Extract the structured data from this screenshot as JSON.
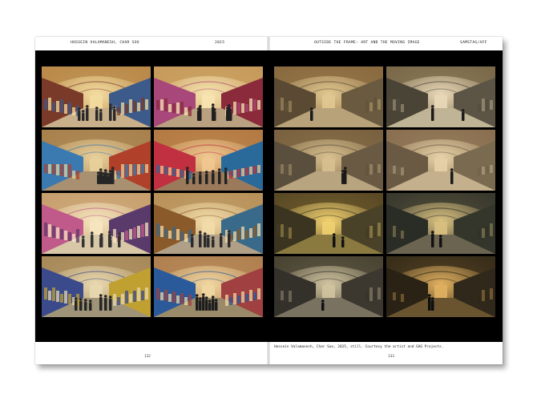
{
  "header": {
    "left_author": "HOSSEIN VALAMANESH, CHAR SOO",
    "left_year": "2015",
    "right_title": "OUTSIDE THE FRAME: ART AND THE MOVING IMAGE",
    "right_org": "SAMSTAG/AFF"
  },
  "caption": "Hossein Valamanesh, Char Soo, 2015, still. Courtesy the artist and GAG Projects.",
  "page_numbers": {
    "left": "132",
    "right": "133"
  },
  "left_frames": [
    {
      "label": "bazaar-busy-1",
      "palette": {
        "vault": "#b98a4a",
        "light": "#f3dca0",
        "wall1": "#7a3a2a",
        "wall2": "#3c5a8a",
        "floor": "#c9b08a",
        "crowd": "#2a2a2a"
      }
    },
    {
      "label": "bazaar-busy-2",
      "palette": {
        "vault": "#c69a5a",
        "light": "#f7e4b0",
        "wall1": "#a8477a",
        "wall2": "#8a2a3a",
        "floor": "#b8a080",
        "crowd": "#1f1f1f"
      }
    },
    {
      "label": "bazaar-busy-3",
      "palette": {
        "vault": "#a8814e",
        "light": "#e8d09a",
        "wall1": "#3a7ab0",
        "wall2": "#b0402a",
        "floor": "#a89070",
        "crowd": "#262626"
      }
    },
    {
      "label": "bazaar-busy-4",
      "palette": {
        "vault": "#b47a44",
        "light": "#f0c890",
        "wall1": "#c03040",
        "wall2": "#2a6a9a",
        "floor": "#9a7a5a",
        "crowd": "#222222"
      }
    },
    {
      "label": "bazaar-busy-5",
      "palette": {
        "vault": "#c8a070",
        "light": "#f6e6c0",
        "wall1": "#c05a8a",
        "wall2": "#5a3a6a",
        "floor": "#d8c8a8",
        "crowd": "#333333"
      }
    },
    {
      "label": "bazaar-busy-6",
      "palette": {
        "vault": "#b8925a",
        "light": "#f2dcaa",
        "wall1": "#8a5a2a",
        "wall2": "#3a6a8a",
        "floor": "#b0a088",
        "crowd": "#2b2b2b"
      }
    },
    {
      "label": "bazaar-busy-7",
      "palette": {
        "vault": "#a88a5a",
        "light": "#e8d8b0",
        "wall1": "#3a4a8a",
        "wall2": "#c0a030",
        "floor": "#a09478",
        "crowd": "#262626"
      }
    },
    {
      "label": "bazaar-busy-8",
      "palette": {
        "vault": "#b08050",
        "light": "#f0d6a0",
        "wall1": "#2a5a9a",
        "wall2": "#a04040",
        "floor": "#9a8a6a",
        "crowd": "#1e1e1e"
      }
    }
  ],
  "right_frames": [
    {
      "label": "bazaar-empty-1",
      "palette": {
        "vault": "#8a6a40",
        "light": "#e0c890",
        "wall1": "#5a4a34",
        "wall2": "#6a5a40",
        "floor": "#b8a27a",
        "crowd": "#1a1a1a"
      }
    },
    {
      "label": "bazaar-empty-2",
      "palette": {
        "vault": "#7a6a4a",
        "light": "#e8d8b8",
        "wall1": "#4a4436",
        "wall2": "#5c5444",
        "floor": "#c0b496",
        "crowd": "#1a1a1a"
      }
    },
    {
      "label": "bazaar-empty-3",
      "palette": {
        "vault": "#7a6240",
        "light": "#d8c090",
        "wall1": "#5a4e3c",
        "wall2": "#6a5a44",
        "floor": "#b8a47e",
        "crowd": "#1a1a1a"
      }
    },
    {
      "label": "bazaar-empty-4",
      "palette": {
        "vault": "#8a7050",
        "light": "#e6d2a8",
        "wall1": "#6a5a44",
        "wall2": "#7a6a50",
        "floor": "#c4b08c",
        "crowd": "#1a1a1a"
      }
    },
    {
      "label": "bazaar-night-1",
      "palette": {
        "vault": "#5a4a24",
        "light": "#f0d070",
        "wall1": "#3a3420",
        "wall2": "#4a4228",
        "floor": "#8a7a40",
        "crowd": "#111111"
      }
    },
    {
      "label": "bazaar-night-2",
      "palette": {
        "vault": "#3a3a2e",
        "light": "#d8c080",
        "wall1": "#2a2c26",
        "wall2": "#34362c",
        "floor": "#6a6450",
        "crowd": "#111111"
      }
    },
    {
      "label": "bazaar-night-3",
      "palette": {
        "vault": "#4a4434",
        "light": "#d0c4a0",
        "wall1": "#34302a",
        "wall2": "#3c3830",
        "floor": "#7a7260",
        "crowd": "#111111"
      }
    },
    {
      "label": "bazaar-night-4",
      "palette": {
        "vault": "#3a2e1a",
        "light": "#e0b060",
        "wall1": "#2a2214",
        "wall2": "#30281a",
        "floor": "#6a5430",
        "crowd": "#0e0e0e"
      }
    }
  ]
}
